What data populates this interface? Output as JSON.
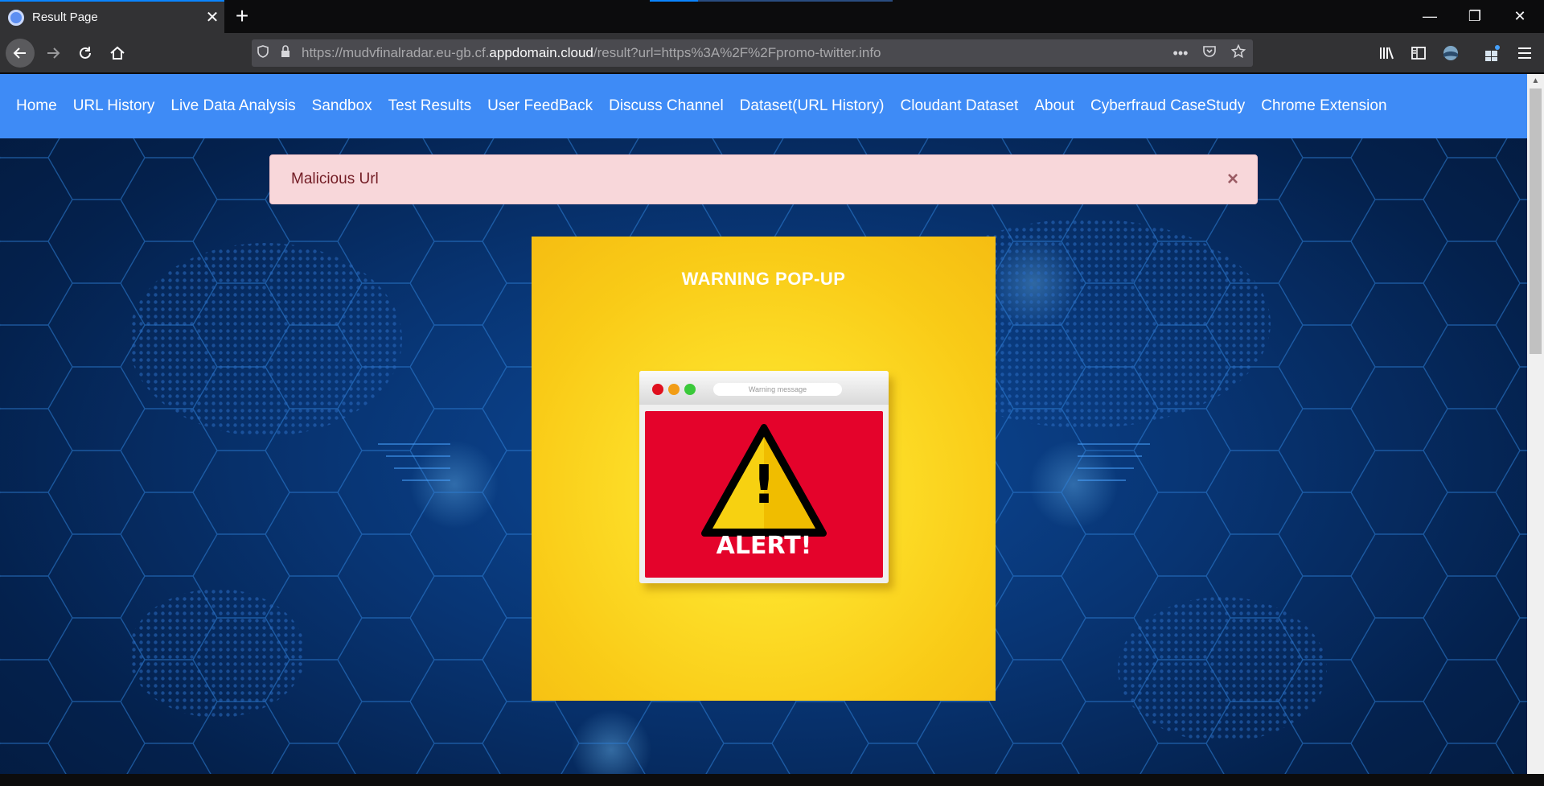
{
  "browser": {
    "tab_title": "Result Page",
    "tab_close": "✕",
    "new_tab": "+",
    "url_prefix": "https://mudvfinalradar.eu-gb.cf.",
    "url_host": "appdomain.cloud",
    "url_suffix": "/result?url=https%3A%2F%2Fpromo-twitter.info",
    "more_actions": "•••",
    "window_controls": {
      "minimize": "—",
      "restore": "❐",
      "close": "✕"
    }
  },
  "nav": {
    "items": [
      "Home",
      "URL History",
      "Live Data Analysis",
      "Sandbox",
      "Test Results",
      "User FeedBack",
      "Discuss Channel",
      "Dataset(URL History)",
      "Cloudant Dataset",
      "About",
      "Cyberfraud CaseStudy",
      "Chrome Extension"
    ]
  },
  "alert": {
    "message": "Malicious Url",
    "close": "×",
    "color": "#f8d7da"
  },
  "warning_card": {
    "title": "WARNING POP-UP",
    "address_bar_text": "Warning message",
    "exclamation": "!",
    "alert_label": "ALERT!",
    "dot_colors": [
      "#e0101e",
      "#f29d16",
      "#3ac93a"
    ]
  },
  "colors": {
    "nav_bg": "#3e8bf6",
    "card_yellow": "#fde02a",
    "popup_red": "#e4032b"
  }
}
